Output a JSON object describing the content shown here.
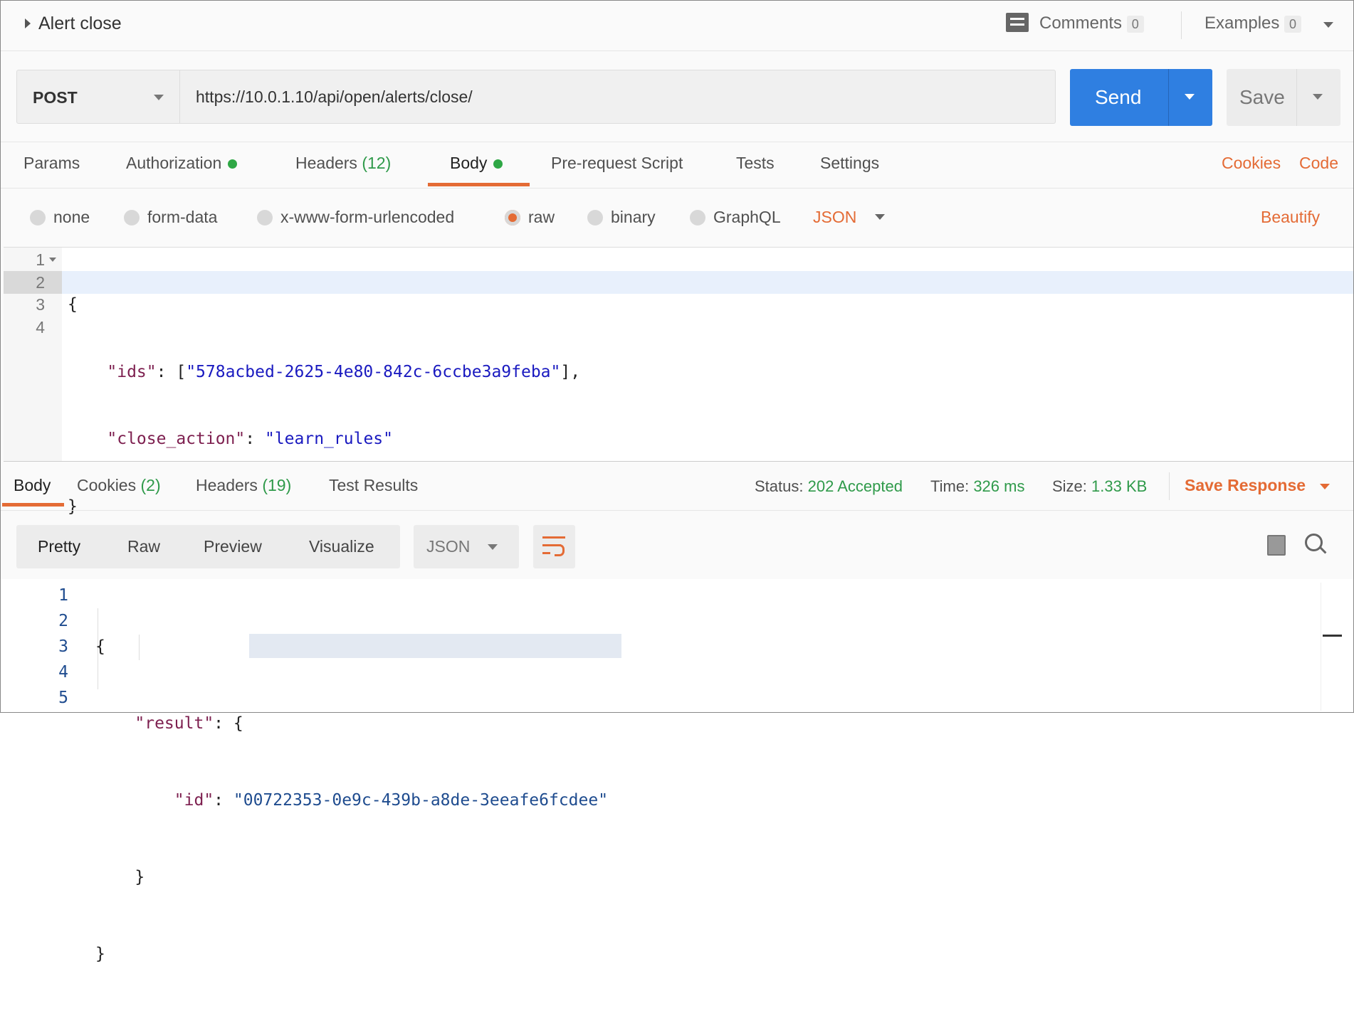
{
  "header": {
    "title": "Alert close",
    "comments_label": "Comments",
    "comments_count": "0",
    "examples_label": "Examples",
    "examples_count": "0"
  },
  "request": {
    "method": "POST",
    "url": "https://10.0.1.10/api/open/alerts/close/",
    "send_label": "Send",
    "save_label": "Save"
  },
  "tabs": [
    {
      "label": "Params"
    },
    {
      "label": "Authorization"
    },
    {
      "label": "Headers",
      "count": "(12)"
    },
    {
      "label": "Body"
    },
    {
      "label": "Pre-request Script"
    },
    {
      "label": "Tests"
    },
    {
      "label": "Settings"
    }
  ],
  "links": {
    "cookies": "Cookies",
    "code": "Code",
    "beautify": "Beautify"
  },
  "body_modes": [
    "none",
    "form-data",
    "x-www-form-urlencoded",
    "raw",
    "binary",
    "GraphQL"
  ],
  "body_mode_selected": "raw",
  "body_format": "JSON",
  "request_body": {
    "line_numbers": [
      "1",
      "2",
      "3",
      "4"
    ],
    "open": "{",
    "ids_key": "\"ids\"",
    "ids_value": "\"578acbed-2625-4e80-842c-6ccbe3a9feba\"",
    "close_key": "\"close_action\"",
    "close_value": "\"learn_rules\"",
    "close": "}"
  },
  "response": {
    "tabs": [
      {
        "label": "Body"
      },
      {
        "label": "Cookies",
        "count": "(2)"
      },
      {
        "label": "Headers",
        "count": "(19)"
      },
      {
        "label": "Test Results"
      }
    ],
    "status_label": "Status:",
    "status": "202 Accepted",
    "time_label": "Time:",
    "time": "326 ms",
    "size_label": "Size:",
    "size": "1.33 KB",
    "save_response": "Save Response",
    "views": [
      "Pretty",
      "Raw",
      "Preview",
      "Visualize"
    ],
    "format": "JSON",
    "body": {
      "line_numbers": [
        "1",
        "2",
        "3",
        "4",
        "5"
      ],
      "result_key": "\"result\"",
      "id_key": "\"id\"",
      "id_value": "\"00722353-0e9c-439b-a8de-3eeafe6fcdee\""
    }
  },
  "colors": {
    "accent": "#e46b35",
    "send": "#2f7fe1",
    "success": "#2f9a4a"
  }
}
